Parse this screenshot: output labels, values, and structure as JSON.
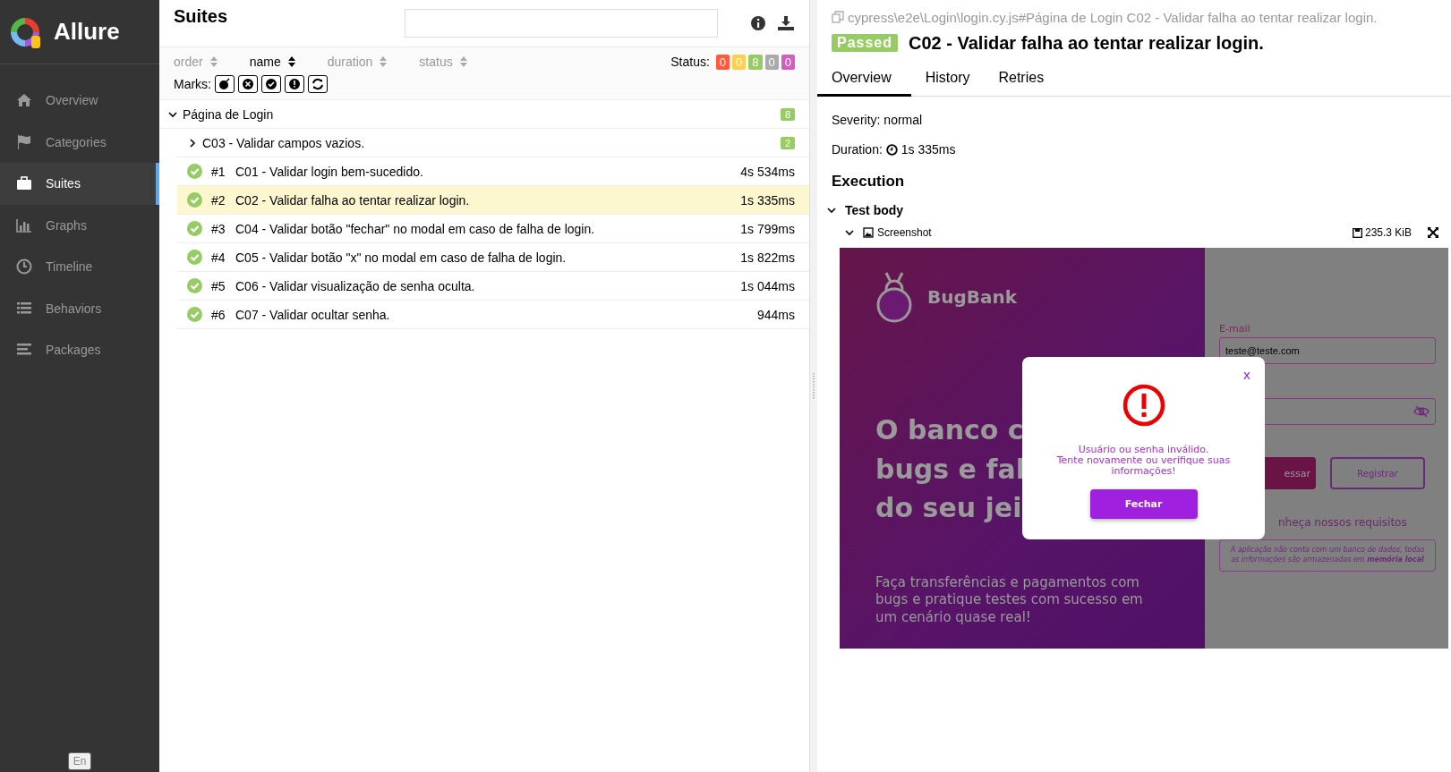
{
  "sidebar": {
    "logo": "Allure",
    "items": [
      {
        "label": "Overview",
        "selected": false
      },
      {
        "label": "Categories",
        "selected": false
      },
      {
        "label": "Suites",
        "selected": true
      },
      {
        "label": "Graphs",
        "selected": false
      },
      {
        "label": "Timeline",
        "selected": false
      },
      {
        "label": "Behaviors",
        "selected": false
      },
      {
        "label": "Packages",
        "selected": false
      }
    ],
    "language": "En"
  },
  "suites": {
    "title": "Suites",
    "sort": [
      {
        "label": "order",
        "selected": false
      },
      {
        "label": "name",
        "selected": true
      },
      {
        "label": "duration",
        "selected": false
      },
      {
        "label": "status",
        "selected": false
      }
    ],
    "status_label": "Status:",
    "status_counts": [
      {
        "count": "0",
        "color": "#fd5a3e"
      },
      {
        "count": "0",
        "color": "#ffd050"
      },
      {
        "count": "8",
        "color": "#97cc64"
      },
      {
        "count": "0",
        "color": "#aaaaaa"
      },
      {
        "count": "0",
        "color": "#d35ebe"
      }
    ],
    "marks_label": "Marks:",
    "tree": [
      {
        "name": "Página de Login",
        "expanded": true,
        "count": "8",
        "children": [
          {
            "kind": "group",
            "name": "C03 - Validar campos vazios.",
            "expanded": false,
            "count": "2"
          },
          {
            "kind": "test",
            "number": "#1",
            "name": "C01 - Validar login bem-sucedido.",
            "duration": "4s 534ms",
            "selected": false
          },
          {
            "kind": "test",
            "number": "#2",
            "name": "C02 - Validar falha ao tentar realizar login.",
            "duration": "1s 335ms",
            "selected": true
          },
          {
            "kind": "test",
            "number": "#3",
            "name": "C04 - Validar botão \"fechar\" no modal em caso de falha de login.",
            "duration": "1s 799ms",
            "selected": false
          },
          {
            "kind": "test",
            "number": "#4",
            "name": "C05 - Validar botão \"x\" no modal em caso de falha de login.",
            "duration": "1s 822ms",
            "selected": false
          },
          {
            "kind": "test",
            "number": "#5",
            "name": "C06 - Validar visualização de senha oculta.",
            "duration": "1s 044ms",
            "selected": false
          },
          {
            "kind": "test",
            "number": "#6",
            "name": "C07 - Validar ocultar senha.",
            "duration": "944ms",
            "selected": false
          }
        ]
      }
    ]
  },
  "detail": {
    "path": "cypress\\e2e\\Login\\login.cy.js#Página de Login C02 - Validar falha ao tentar realizar login.",
    "status": "Passed",
    "title": "C02 - Validar falha ao tentar realizar login.",
    "tabs": [
      {
        "label": "Overview",
        "selected": true
      },
      {
        "label": "History",
        "selected": false
      },
      {
        "label": "Retries",
        "selected": false
      }
    ],
    "severity": "Severity: normal",
    "duration_label": "Duration:",
    "duration": "1s 335ms",
    "execution": "Execution",
    "step": {
      "name": "Test body",
      "expanded": true
    },
    "attachment": {
      "name": "Screenshot",
      "expanded": true,
      "size": "235.3 KiB"
    },
    "screenshot": {
      "brand": "BugBank",
      "headline": [
        "O banco c",
        "bugs e fal",
        "do seu jei"
      ],
      "tagline": "Faça transferências e pagamentos com bugs e pratique testes com sucesso em um cenário quase real!",
      "email_label": "E-mail",
      "email_value": "teste@teste.com",
      "login_button": "essar",
      "register_button": "Registrar",
      "requirements_link": "nheça nossos requisitos",
      "notice": "A aplicação não conta com um banco de dados, todas as informações são armazenadas em **memória local**",
      "modal": {
        "close": "x",
        "message": [
          "Usuário ou senha inválido.",
          "Tente novamente ou verifique suas informações!"
        ],
        "button": "Fechar"
      }
    }
  }
}
